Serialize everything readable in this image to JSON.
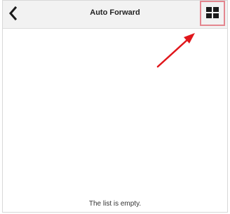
{
  "header": {
    "title": "Auto Forward",
    "back_icon": "chevron-left-icon",
    "view_toggle_icon": "grid-view-icon"
  },
  "annotation": {
    "highlight_color": "#e4868f",
    "arrow_color": "#e0161b"
  },
  "list": {
    "empty_message": "The list is empty."
  }
}
